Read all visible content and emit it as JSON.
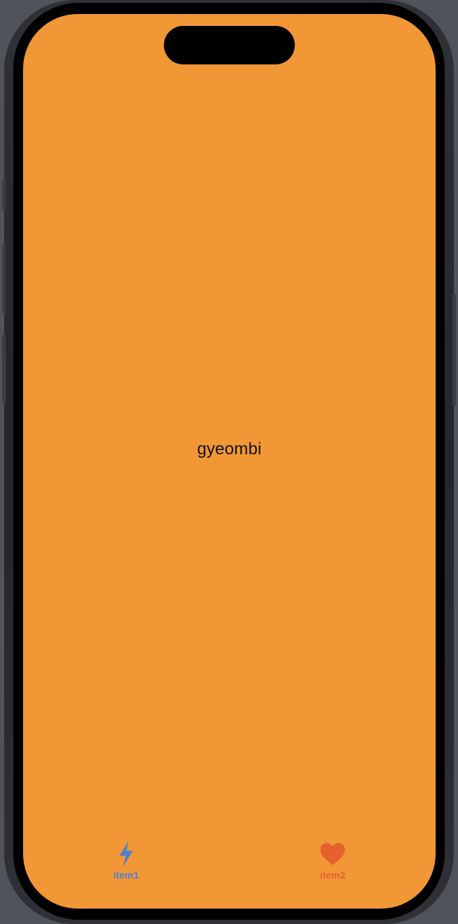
{
  "screen": {
    "background_color": "#f19736",
    "center_text": "gyeombi"
  },
  "tab_bar": {
    "items": [
      {
        "label": "item1",
        "icon": "bolt-icon",
        "color": "#4c80d0",
        "selected": true
      },
      {
        "label": "item2",
        "icon": "heart-icon",
        "color": "#e5622f",
        "selected": false
      }
    ]
  }
}
